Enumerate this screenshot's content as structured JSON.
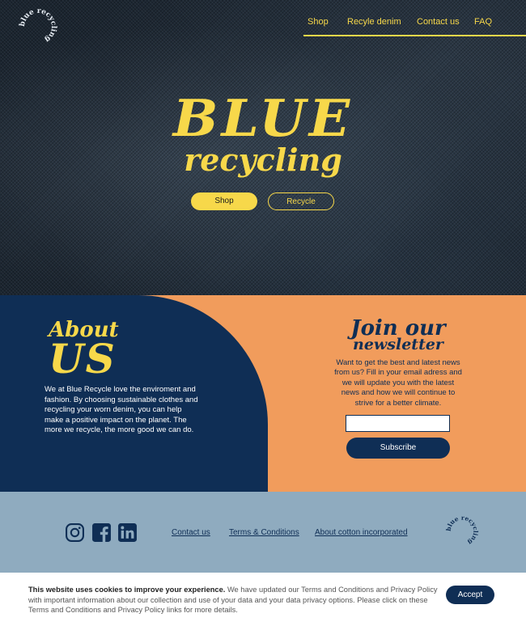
{
  "brand": {
    "logo_text": "blue recycling",
    "accent_color": "#f7d84a",
    "navy_color": "#0f2e55",
    "orange_color": "#f19c5c",
    "footer_color": "#8fabbf"
  },
  "nav": {
    "items": [
      {
        "label": "Shop"
      },
      {
        "label": "Recyle denim"
      },
      {
        "label": "Contact us"
      },
      {
        "label": "FAQ"
      }
    ]
  },
  "hero": {
    "title": "BLUE",
    "subtitle": "recycling",
    "shop_label": "Shop",
    "recycle_label": "Recycle"
  },
  "about": {
    "title_line1": "About",
    "title_line2": "US",
    "text": "We at Blue Recycle love the enviroment and fashion. By choosing sustainable clothes and recycling your worn denim, you can help make a positive impact on the planet. The more we recycle, the more good we can do."
  },
  "newsletter": {
    "title_line1": "Join our",
    "title_line2": "newsletter",
    "text": "Want to get the best and latest news from us? Fill in your email adress and we will update you with the latest news and how we will continue to strive for a better climate.",
    "email_value": "",
    "subscribe_label": "Subscribe"
  },
  "footer": {
    "social_icons": [
      "instagram-icon",
      "facebook-icon",
      "linkedin-icon"
    ],
    "links": [
      {
        "label": "Contact us"
      },
      {
        "label": "Terms & Conditions"
      },
      {
        "label": "About cotton incorporated"
      }
    ]
  },
  "cookie": {
    "bold_text": "This website uses cookies to improve your experience.",
    "text": " We have updated our Terms and Conditions and Privacy Policy with important information about our collection and use of your data and your data privacy options. Please click on these Terms and Conditions and Privacy Policy links for more details.",
    "accept_label": "Accept"
  }
}
